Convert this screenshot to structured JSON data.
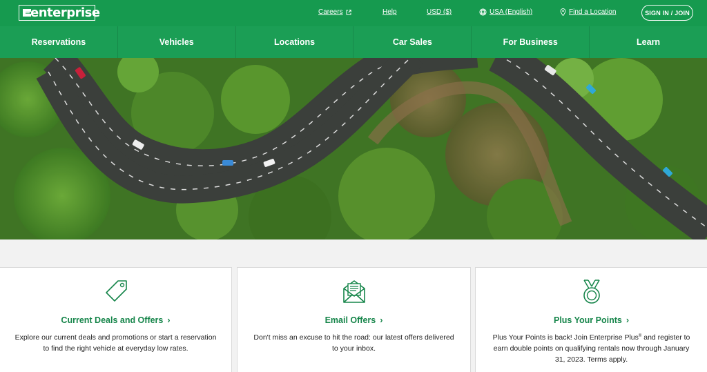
{
  "brand": {
    "logo_text": "enterprise",
    "logo_color": "#ffffff",
    "bar_color": "#169a4f"
  },
  "utility": {
    "careers": "Careers",
    "help": "Help",
    "currency": "USD ($)",
    "region": "USA (English)",
    "find_location": "Find a Location",
    "signin": "SIGN IN / JOIN"
  },
  "nav": {
    "items": [
      {
        "label": "Reservations"
      },
      {
        "label": "Vehicles"
      },
      {
        "label": "Locations"
      },
      {
        "label": "Car Sales"
      },
      {
        "label": "For Business"
      },
      {
        "label": "Learn"
      }
    ]
  },
  "cards": [
    {
      "icon": "tag-icon",
      "title": "Current Deals and Offers",
      "body": "Explore our current deals and promotions or start a reservation to find the right vehicle at everyday low rates."
    },
    {
      "icon": "email-envelope-icon",
      "title": "Email Offers",
      "body": "Don't miss an excuse to hit the road: our latest offers delivered to your inbox."
    },
    {
      "icon": "medal-icon",
      "title": "Plus Your Points",
      "body_before": "Plus Your Points is back! Join Enterprise Plus",
      "body_sup": "®",
      "body_after": " and register to earn double points on qualifying rentals now through January 31, 2023. Terms apply."
    }
  ],
  "colors": {
    "accent_green": "#16854a",
    "nav_green": "#1b9e55"
  }
}
